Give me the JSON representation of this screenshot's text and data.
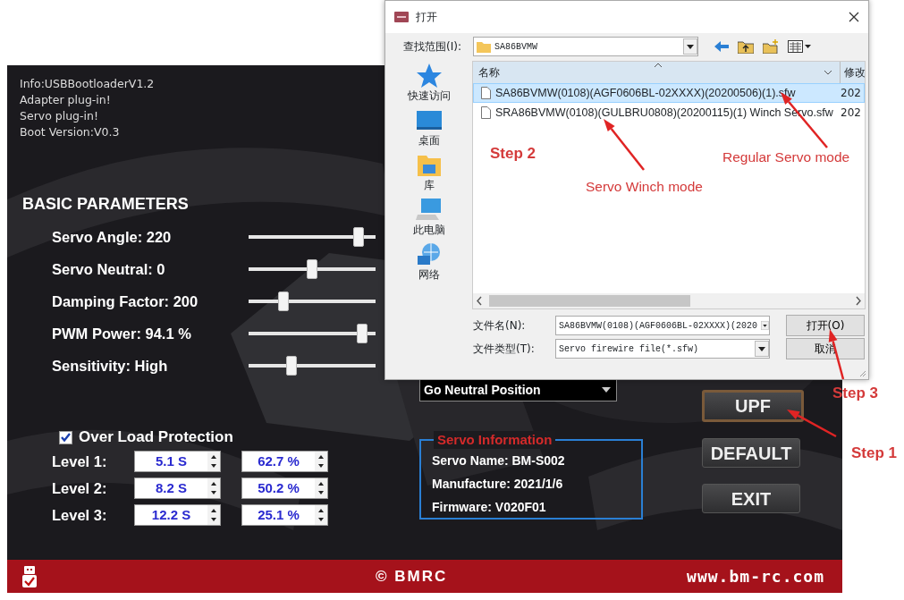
{
  "app": {
    "info_lines": [
      "Info:USBBootloaderV1.2",
      "Adapter plug-in!",
      "Servo plug-in!",
      "Boot Version:V0.3"
    ],
    "section_title": "BASIC PARAMETERS",
    "parameters": [
      {
        "label": "Servo Angle: 220",
        "level": 0.9
      },
      {
        "label": "Servo Neutral: 0",
        "level": 0.5
      },
      {
        "label": "Damping Factor: 200",
        "level": 0.25
      },
      {
        "label": "PWM Power: 94.1 %",
        "level": 0.93
      },
      {
        "label": "Sensitivity: High",
        "level": 0.32
      }
    ],
    "mode_select": {
      "value": "Go Neutral Position"
    },
    "overload": {
      "label": "Over Load Protection",
      "checked": true,
      "levels": [
        {
          "label": "Level 1:",
          "time": "5.1 S",
          "percent": "62.7 %"
        },
        {
          "label": "Level 2:",
          "time": "8.2 S",
          "percent": "50.2 %"
        },
        {
          "label": "Level 3:",
          "time": "12.2 S",
          "percent": "25.1 %"
        }
      ]
    },
    "servo_info": {
      "title": "Servo Information",
      "lines": [
        "Servo Name: BM-S002",
        "Manufacture: 2021/1/6",
        "Firmware: V020F01"
      ]
    },
    "buttons": [
      {
        "label": "UPF",
        "focused": true
      },
      {
        "label": "DEFAULT",
        "focused": false
      },
      {
        "label": "EXIT",
        "focused": false
      }
    ],
    "footer": {
      "copyright": "© BMRC",
      "website": "www.bm-rc.com"
    }
  },
  "dialog": {
    "title": "打开",
    "look_in_label": "查找范围(I):",
    "look_in_value": "SA86BVMW",
    "places": [
      "快速访问",
      "桌面",
      "库",
      "此电脑",
      "网络"
    ],
    "columns": [
      "名称",
      "修改"
    ],
    "files": [
      {
        "name": "SA86BVMW(0108)(AGF0606BL-02XXXX)(20200506)(1).sfw",
        "date": "202",
        "selected": true
      },
      {
        "name": "SRA86BVMW(0108)(GULBRU0808)(20200115)(1) Winch Servo.sfw",
        "date": "202",
        "selected": false
      }
    ],
    "file_name_label": "文件名(N):",
    "file_name_value": "SA86BVMW(0108)(AGF0606BL-02XXXX)(2020",
    "file_type_label": "文件类型(T):",
    "file_type_value": "Servo firewire file(*.sfw)",
    "buttons": [
      "打开(O)",
      "取消"
    ]
  },
  "annotations": [
    {
      "text": "Step 2",
      "kind": "step"
    },
    {
      "text": "Servo Winch mode",
      "kind": "note"
    },
    {
      "text": "Regular Servo mode",
      "kind": "note"
    },
    {
      "text": "Step 3",
      "kind": "step"
    },
    {
      "text": "Step 1",
      "kind": "step"
    }
  ]
}
